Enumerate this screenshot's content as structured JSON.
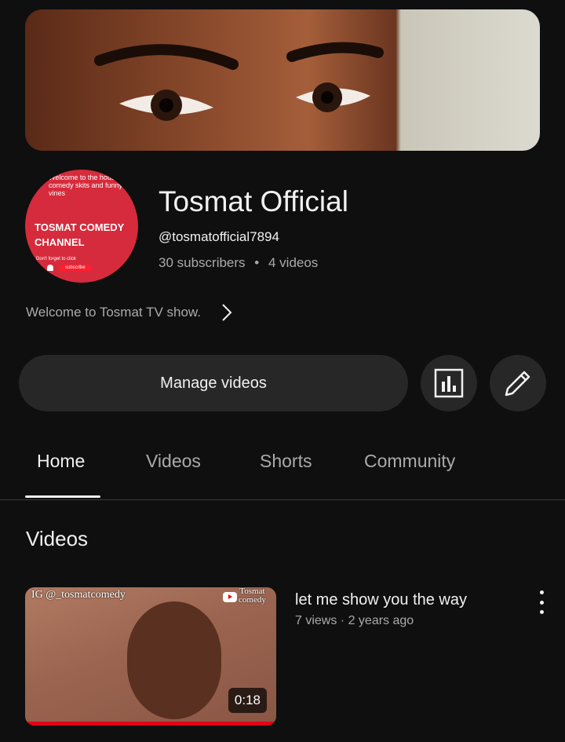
{
  "channel": {
    "title": "Tosmat Official",
    "handle": "@tosmatofficial7894",
    "subscribers": "30 subscribers",
    "separator": "•",
    "videos_count": "4 videos",
    "description": "Welcome to Tosmat TV show."
  },
  "avatar": {
    "small_text": "Welcome to the house of comedy skits and funny vines",
    "big_text_line1": "TOSMAT COMEDY",
    "big_text_line2": "CHANNEL",
    "bottom_text": "Don't forget to click",
    "subscribe_pill": "subscribe"
  },
  "actions": {
    "manage_label": "Manage videos",
    "analytics_icon": "analytics-icon",
    "edit_icon": "pencil-icon"
  },
  "tabs": [
    {
      "label": "Home",
      "active": true
    },
    {
      "label": "Videos",
      "active": false
    },
    {
      "label": "Shorts",
      "active": false
    },
    {
      "label": "Community",
      "active": false
    }
  ],
  "section": {
    "title": "Videos"
  },
  "video": {
    "title": "let me show you the way",
    "meta": "7 views · 2 years ago",
    "duration": "0:18",
    "overlay_ig": "IG @_tosmatcomedy",
    "overlay_brand_line1": "Tosmat",
    "overlay_brand_line2": "comedy",
    "watched_fraction": 1.0
  },
  "colors": {
    "background": "#0f0f0f",
    "button_bg": "#272727",
    "secondary_text": "#aaaaaa",
    "accent_red": "#e2001a"
  }
}
